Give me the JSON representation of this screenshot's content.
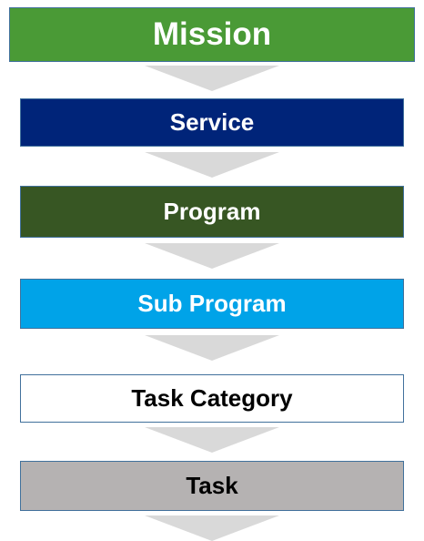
{
  "levels": [
    {
      "label": "Mission",
      "bg": "#4a9a36",
      "fg": "#ffffff"
    },
    {
      "label": "Service",
      "bg": "#002479",
      "fg": "#ffffff"
    },
    {
      "label": "Program",
      "bg": "#375623",
      "fg": "#ffffff"
    },
    {
      "label": "Sub Program",
      "bg": "#00a3e8",
      "fg": "#ffffff"
    },
    {
      "label": "Task Category",
      "bg": "#ffffff",
      "fg": "#000000"
    },
    {
      "label": "Task",
      "bg": "#b5b2b2",
      "fg": "#000000"
    }
  ],
  "connector": {
    "icon": "down-chevron-arrow-icon",
    "color": "#d9d9d9"
  }
}
